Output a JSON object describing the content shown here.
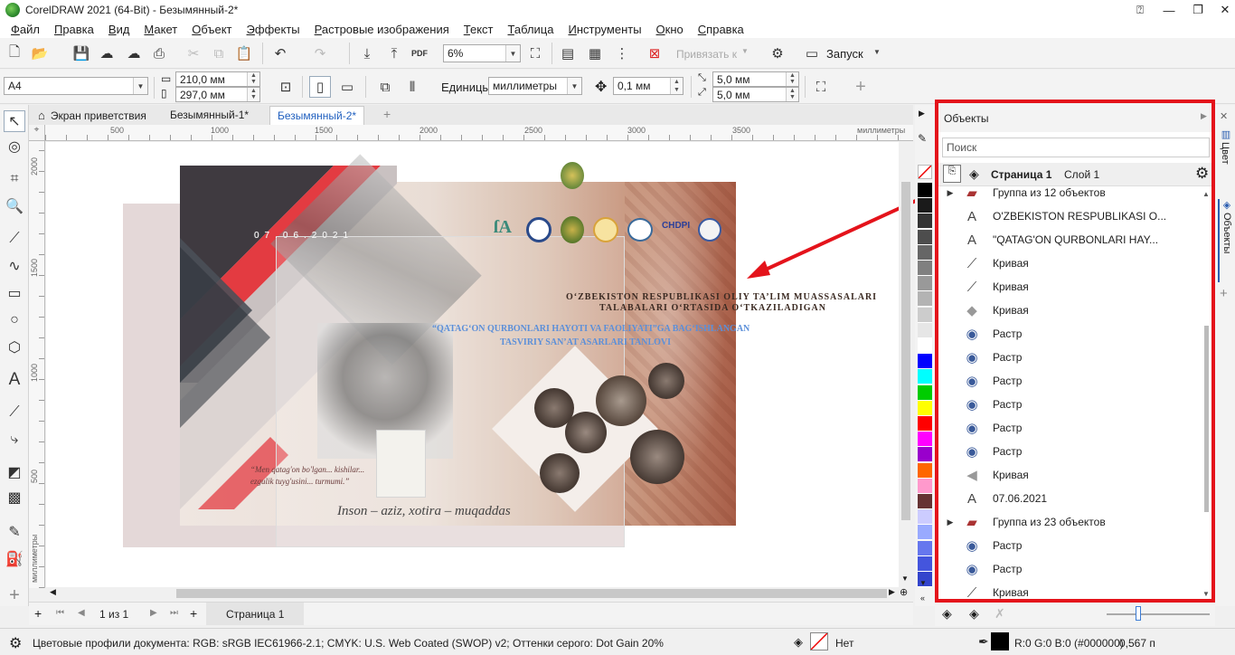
{
  "window": {
    "title": "CorelDRAW 2021 (64-Bit) - Безымянный-2*"
  },
  "menu": [
    "Файл",
    "Правка",
    "Вид",
    "Макет",
    "Объект",
    "Эффекты",
    "Растровые изображения",
    "Текст",
    "Таблица",
    "Инструменты",
    "Окно",
    "Справка"
  ],
  "toolbar1": {
    "zoom": "6%",
    "snap_label": "Привязать к",
    "launch_label": "Запуск",
    "pdf_label": "PDF"
  },
  "toolbar2": {
    "page_size": "A4",
    "width": "210,0 мм",
    "height": "297,0 мм",
    "units_label": "Единицы:",
    "units_value": "миллиметры",
    "nudge": "0,1 мм",
    "dup_x": "5,0 мм",
    "dup_y": "5,0 мм"
  },
  "doc_tabs": [
    "Экран приветствия",
    "Безымянный-1*",
    "Безымянный-2*"
  ],
  "ruler": {
    "h_labels": [
      "500",
      "1000",
      "1500",
      "2000",
      "2500",
      "3000",
      "3500"
    ],
    "h_unit": "миллиметры",
    "v_labels": [
      "2000",
      "1500",
      "1000",
      "500"
    ],
    "v_unit": "миллиметры"
  },
  "artwork": {
    "date": "07.06.2021",
    "line1": "O‘ZBEKISTON RESPUBLIKASI OLIY TA’LIM MUASSASALARI",
    "line2": "TALABALARI O‘RTASIDA O‘TKAZILADIGAN",
    "line3": "“QATAG‘ON QURBONLARI HAYOTI VA FAOLIYATI”GA BAG‘ISHLANGAN",
    "line4": "TASVIRIY SAN’AT ASARLARI TANLOVI",
    "quote": "“Men qatag'on bo'lgan... kishilar... ezgulik tuyg'usini... turmumi.”",
    "signature": "Inson – aziz, xotira – muqaddas",
    "logo_text": "CHDPI"
  },
  "page_nav": {
    "counter": "1 из 1",
    "page_tab": "Страница 1"
  },
  "docker": {
    "title": "Объекты",
    "search_placeholder": "Поиск",
    "page_label": "Страница 1",
    "layer_label": "Слой 1",
    "items": [
      {
        "label": "Группа из 12 объектов",
        "icon": "group-icon",
        "expand": "▶"
      },
      {
        "label": "O'ZBEKISTON RESPUBLIKASI O...",
        "icon": "text-icon",
        "expand": ""
      },
      {
        "label": "\"QATAG'ON QURBONLARI HAY...",
        "icon": "text-icon",
        "expand": ""
      },
      {
        "label": "Кривая",
        "icon": "curve-icon",
        "expand": ""
      },
      {
        "label": "Кривая",
        "icon": "curve-icon",
        "expand": ""
      },
      {
        "label": "Кривая",
        "icon": "diamond-icon",
        "expand": ""
      },
      {
        "label": "Растр",
        "icon": "bitmap-icon",
        "expand": ""
      },
      {
        "label": "Растр",
        "icon": "bitmap-icon",
        "expand": ""
      },
      {
        "label": "Растр",
        "icon": "bitmap-icon",
        "expand": ""
      },
      {
        "label": "Растр",
        "icon": "bitmap-icon",
        "expand": ""
      },
      {
        "label": "Растр",
        "icon": "bitmap-icon",
        "expand": ""
      },
      {
        "label": "Растр",
        "icon": "bitmap-icon",
        "expand": ""
      },
      {
        "label": "Кривая",
        "icon": "triangle-icon",
        "expand": ""
      },
      {
        "label": "07.06.2021",
        "icon": "text-icon",
        "expand": ""
      },
      {
        "label": "Группа из 23 объектов",
        "icon": "group-icon",
        "expand": "▶"
      },
      {
        "label": "Растр",
        "icon": "bitmap-icon",
        "expand": ""
      },
      {
        "label": "Растр",
        "icon": "bitmap-icon",
        "expand": ""
      },
      {
        "label": "Кривая",
        "icon": "curve-icon",
        "expand": ""
      }
    ]
  },
  "right_tabs": [
    "Цвет",
    "Объекты"
  ],
  "palette": [
    "#000000",
    "#1a1a1a",
    "#333333",
    "#4d4d4d",
    "#666666",
    "#808080",
    "#999999",
    "#b3b3b3",
    "#cccccc",
    "#e6e6e6",
    "#ffffff",
    "#0000ff",
    "#00ffff",
    "#00cc00",
    "#ffff00",
    "#ff0000",
    "#ff00ff",
    "#9900cc",
    "#ff6600",
    "#ff99cc",
    "#663333",
    "#ccccff",
    "#99aaff",
    "#6677ee",
    "#4455dd",
    "#3344cc"
  ],
  "status": {
    "profiles": "Цветовые профили документа: RGB: sRGB IEC61966-2.1; CMYK: U.S. Web Coated (SWOP) v2; Оттенки серого: Dot Gain 20%",
    "fill": "Нет",
    "outline": "R:0 G:0 B:0 (#000000)",
    "outline_width": "0,567 п"
  }
}
